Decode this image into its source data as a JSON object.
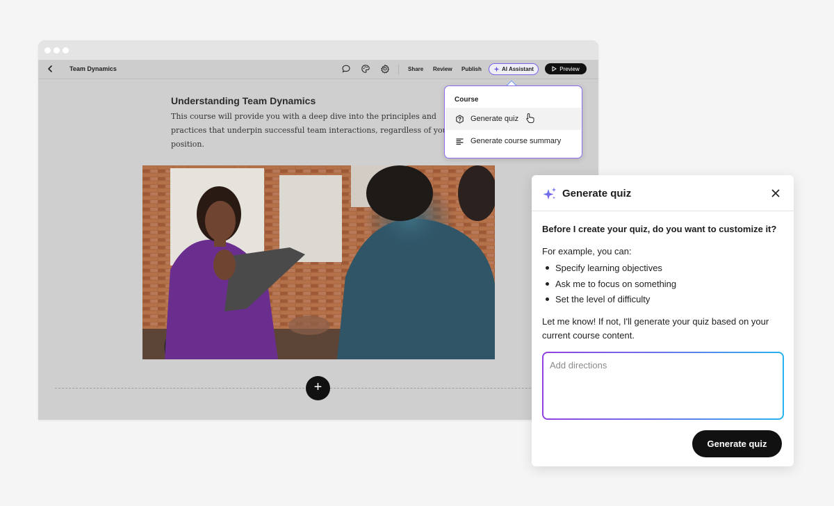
{
  "toolbar": {
    "course_title": "Team Dynamics",
    "share_label": "Share",
    "review_label": "Review",
    "publish_label": "Publish",
    "ai_assistant_label": "AI Assistant",
    "preview_label": "Preview"
  },
  "page": {
    "heading": "Understanding Team Dynamics",
    "body": "This course will provide you with a deep dive into the principles and practices that underpin successful team interactions, regardless of your position.",
    "add_block_symbol": "+"
  },
  "ai_menu": {
    "section": "Course",
    "items": [
      {
        "label": "Generate quiz",
        "icon": "quiz-question-icon"
      },
      {
        "label": "Generate course summary",
        "icon": "summary-lines-icon"
      }
    ]
  },
  "dialog": {
    "title": "Generate quiz",
    "question": "Before I create your quiz, do you want to customize it?",
    "intro": "For example, you can:",
    "options": [
      "Specify learning objectives",
      "Ask me to focus on something",
      "Set the level of difficulty"
    ],
    "outro": "Let me know! If not, I'll generate your quiz based on your current course content.",
    "input_placeholder": "Add directions",
    "submit_label": "Generate quiz"
  },
  "colors": {
    "accent_purple": "#8e6cf0",
    "accent_blue": "#27b3ee",
    "button_dark": "#111111"
  }
}
